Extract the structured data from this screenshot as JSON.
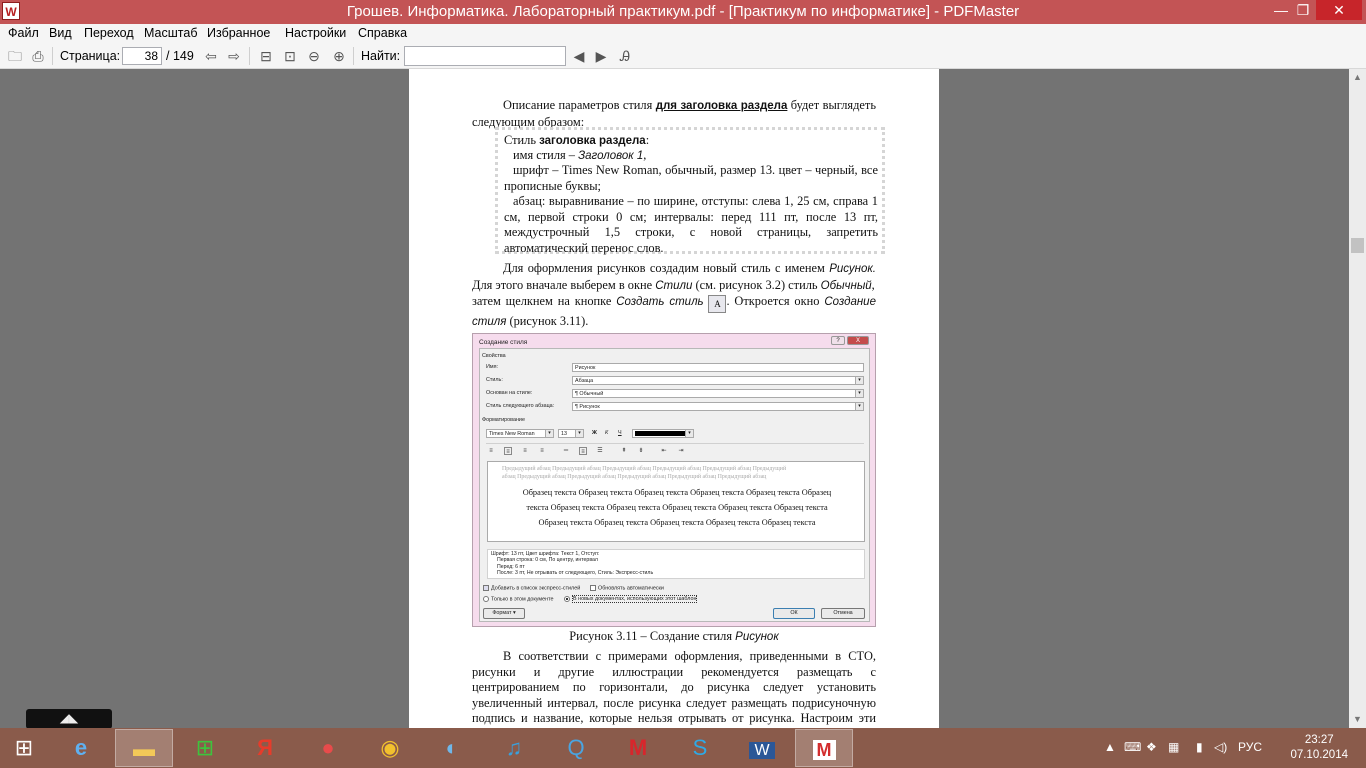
{
  "window": {
    "title": "Грошев. Информатика. Лабораторный практикум.pdf - [Практикум по информатике] - PDFMaster",
    "app_logo": "W",
    "minimize": "—",
    "maximize": "❐",
    "close": "✕"
  },
  "menu": [
    "Файл",
    "Вид",
    "Переход",
    "Масштаб",
    "Избранное",
    "Настройки",
    "Справка"
  ],
  "toolbar": {
    "page_label": "Страница:",
    "page_value": "38",
    "page_total": "/ 149",
    "find_label": "Найти:",
    "find_value": ""
  },
  "page": {
    "para1_a": "Описание параметров стиля ",
    "para1_b": "для заголовка раздела",
    "para1_c": " будет выглядеть следующим образом:",
    "box": {
      "l1_a": "Стиль ",
      "l1_b": "заголовка раздела",
      "l1_c": ":",
      "l2_a": "имя стиля – ",
      "l2_b": "Заголовок 1",
      "l2_c": ",",
      "l3": "шрифт – Times New Roman, обычный, размер 13. цвет – черный, все прописные буквы;",
      "l4": "абзац: выравнивание – по ширине, отступы: слева 1, 25  см, справа 1 см, первой строки 0 см; интервалы: перед 111 пт, после 13 пт, междустрочный 1,5 строки, с новой страницы, запретить автоматический перенос слов."
    },
    "para2_a": "Для оформления рисунков создадим новый стиль с именем ",
    "para2_b": "Рисунок.",
    "para2_c": " Для этого вначале выберем в окне ",
    "para2_d": "Стили",
    "para2_e": " (см. рисунок 3.2) стиль ",
    "para2_f": "Обычный",
    "para2_g": ",",
    "para3_a": "затем щелкнем на кнопке ",
    "para3_b": "Создать стиль",
    "para3_c": ". Откроется окно ",
    "para3_d": "Создание стиля",
    "para3_e": " (рисунок 3.11).",
    "caption_a": "Рисунок 3.11 – Создание стиля ",
    "caption_b": "Рисунок",
    "para4": "В соответствии с примерами оформления, приведенными в СТО, рисунки и другие иллюстрации рекомендуется размещать с центрированием по горизонтали, до рисунка следует установить увеличенный интервал, после рисунка следует размещать подрисуночную подпись и название, которые нельзя отрывать от рисунка. Настроим эти параметры для нового сти-"
  },
  "dialog": {
    "title": "Создание стиля",
    "help": "?",
    "close": "X",
    "section_props": "Свойства",
    "name_label": "Имя:",
    "name_value": "Рисунок",
    "style_label": "Стиль:",
    "style_value": "Абзаца",
    "based_label": "Основан на стиле:",
    "based_value": "¶ Обычный",
    "next_label": "Стиль следующего абзаца:",
    "next_value": "¶ Рисунок",
    "section_format": "Форматирование",
    "font_value": "Times New Roman",
    "size_value": "13",
    "bold": "Ж",
    "italic": "К",
    "underline": "Ч",
    "preview_gray1": "Предыдущий абзац Предыдущий абзац Предыдущий абзац Предыдущий абзац Предыдущий абзац Предыдущий",
    "preview_gray2": "абзац Предыдущий абзац Предыдущий абзац Предыдущий абзац Предыдущий абзац Предыдущий абзац",
    "sample1": "Образец текста Образец текста Образец текста Образец текста Образец текста Образец",
    "sample2": "текста Образец текста Образец текста Образец текста Образец текста Образец текста",
    "sample3": "Образец текста Образец текста Образец текста Образец текста Образец текста",
    "desc1": "Шрифт: 13 пт, Цвет шрифта: Текст 1, Отступ:",
    "desc2": "Первая строка:  0 см, По центру, интервал",
    "desc3": "Перед:  6 пт",
    "desc4": "После:  3 пт, Не отрывать от следующего, Стиль: Экспресс-стиль",
    "chk_quick": "Добавить в список экспресс-стилей",
    "chk_auto": "Обновлять автоматически",
    "radio_doc": "Только в этом документе",
    "radio_new": "В новых документах, использующих этот шаблон",
    "format_btn": "Формат ▾",
    "ok_btn": "ОК",
    "cancel_btn": "Отмена"
  },
  "tray": {
    "lang": "РУС",
    "time": "23:27",
    "date": "07.10.2014"
  },
  "colors": {
    "titlebar": "#c35455",
    "taskbar": "#8a5b4b",
    "viewport": "#737373"
  }
}
